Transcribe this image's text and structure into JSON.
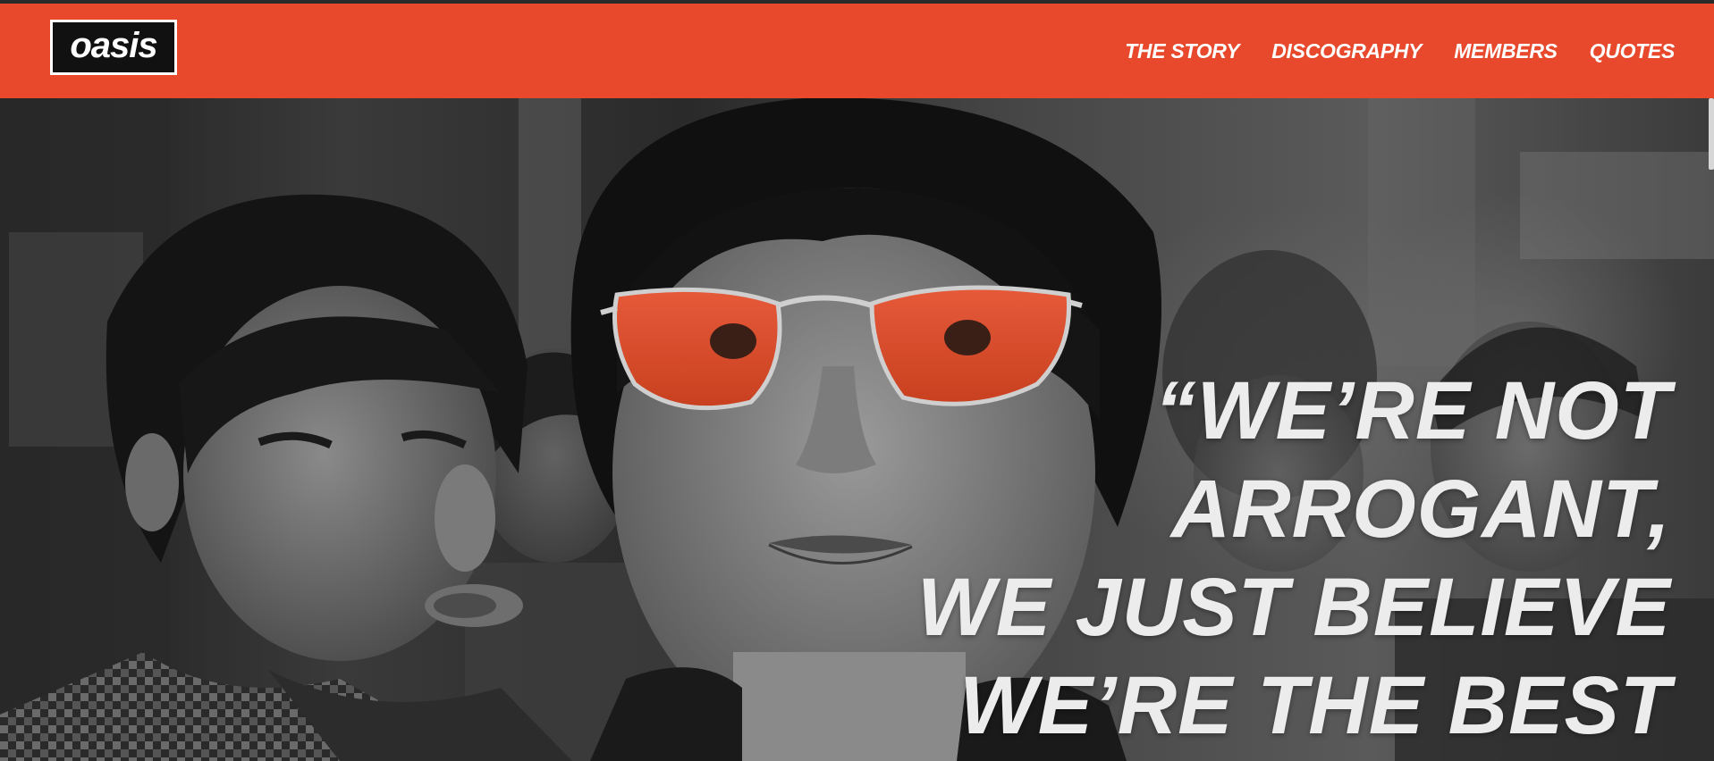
{
  "brand": {
    "logo_text": "oasis",
    "accent_color": "#e8482b"
  },
  "nav": {
    "items": [
      {
        "label": "THE STORY"
      },
      {
        "label": "DISCOGRAPHY"
      },
      {
        "label": "MEMBERS"
      },
      {
        "label": "QUOTES"
      }
    ]
  },
  "hero": {
    "quote_lines": [
      "“WE’RE NOT",
      "ARROGANT,",
      "WE JUST BELIEVE",
      "WE’RE THE BEST"
    ],
    "image_icon": "band-photo"
  }
}
